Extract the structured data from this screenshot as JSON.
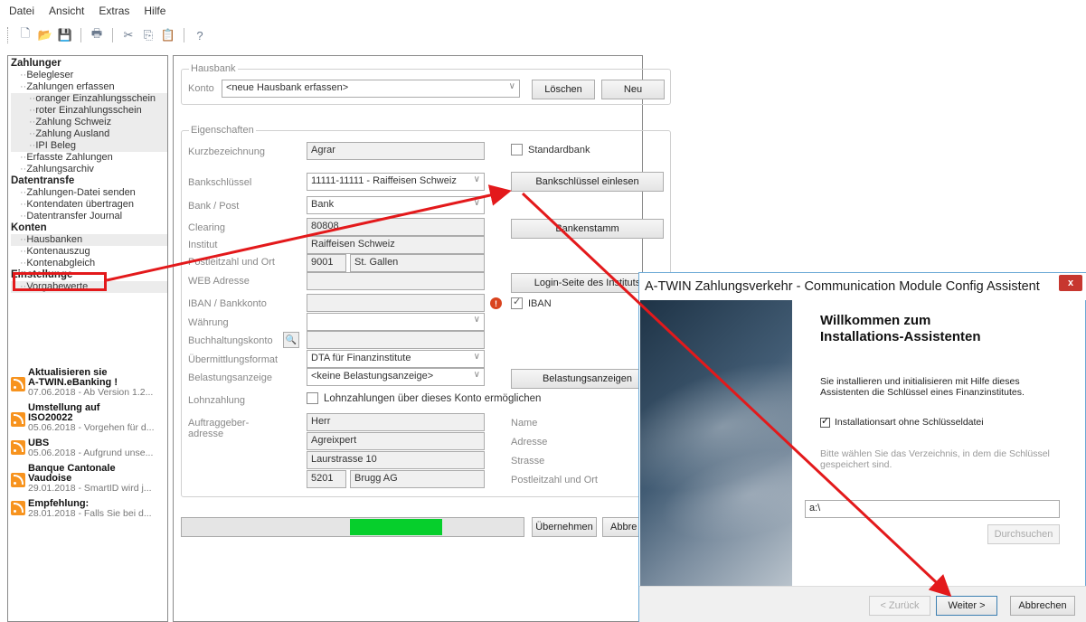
{
  "menubar": {
    "items": [
      "Datei",
      "Ansicht",
      "Extras",
      "Hilfe"
    ]
  },
  "toolbar": {
    "icons": [
      "new-icon",
      "open-icon",
      "save-icon",
      "print-icon",
      "cut-icon",
      "copy-icon",
      "paste-icon",
      "help-icon"
    ]
  },
  "nav": {
    "zahlungen": {
      "heading": "Zahlunger",
      "items": [
        "Belegleser",
        "Zahlungen erfassen",
        "oranger Einzahlungsschein",
        "roter Einzahlungsschein",
        "Zahlung Schweiz",
        "Zahlung Ausland",
        "IPI Beleg",
        "Erfasste Zahlungen",
        "Zahlungsarchiv"
      ]
    },
    "datentransfer": {
      "heading": "Datentransfe",
      "items": [
        "Zahlungen-Datei senden",
        "Kontendaten übertragen",
        "Datentransfer Journal"
      ]
    },
    "konten": {
      "heading": "Konten",
      "items": [
        "Hausbanken",
        "Kontenauszug",
        "Kontenabgleich"
      ]
    },
    "einstellungen": {
      "heading": "Einstellunge",
      "items": [
        "Vorgabewerte"
      ]
    },
    "news": [
      {
        "title1": "Aktualisieren sie",
        "title2": "A-TWIN.eBanking !",
        "sub": "07.06.2018 - Ab Version 1.2..."
      },
      {
        "title1": "Umstellung auf",
        "title2": "ISO20022",
        "sub": "05.06.2018 - Vorgehen für d..."
      },
      {
        "title1": "UBS",
        "title2": "",
        "sub": "05.06.2018 - Aufgrund unse..."
      },
      {
        "title1": "Banque Cantonale",
        "title2": "Vaudoise",
        "sub": "29.01.2018 - SmartID wird j..."
      },
      {
        "title1": "Empfehlung:",
        "title2": "",
        "sub": "28.01.2018 - Falls Sie bei d..."
      }
    ]
  },
  "hausbank": {
    "legend": "Hausbank",
    "konto_label": "Konto",
    "konto_value": "<neue Hausbank erfassen>",
    "loeschen": "Löschen",
    "neu": "Neu"
  },
  "eigenschaften": {
    "legend": "Eigenschaften",
    "kurzbezeichnung_label": "Kurzbezeichnung",
    "kurzbezeichnung_value": "Agrar",
    "standardbank_label": "Standardbank",
    "bankschluessel_label": "Bankschlüssel",
    "bankschluessel_value": "11111-11111 - Raiffeisen Schweiz",
    "bankschluessel_btn": "Bankschlüssel einlesen",
    "bankpost_label": "Bank / Post",
    "bankpost_value": "Bank",
    "clearing_label": "Clearing",
    "clearing_value": "80808",
    "bankenstamm_btn": "Bankenstamm",
    "institut_label": "Institut",
    "institut_value": "Raiffeisen Schweiz",
    "plzort_label": "Postleitzahl und Ort",
    "plz_value": "9001",
    "ort_value": "St. Gallen",
    "web_label": "WEB Adresse",
    "login_btn": "Login-Seite des Instituts",
    "iban_label": "IBAN / Bankkonto",
    "iban_chk_label": "IBAN",
    "waehrung_label": "Währung",
    "buchhaltung_label": "Buchhaltungskonto",
    "uebermittlung_label": "Übermittlungsformat",
    "uebermittlung_value": "DTA für Finanzinstitute",
    "belastung_label": "Belastungsanzeige",
    "belastung_value": "<keine Belastungsanzeige>",
    "belastung_btn": "Belastungsanzeigen",
    "lohn_label": "Lohnzahlung",
    "lohn_chk_label": "Lohnzahlungen über dieses Konto ermöglichen",
    "auftrag_label1": "Auftraggeber-",
    "auftrag_label2": "adresse",
    "name_value": "Herr",
    "name_label": "Name",
    "adresse_value": "Agreixpert",
    "adresse_label": "Adresse",
    "strasse_value": "Laurstrasse 10",
    "strasse_label": "Strasse",
    "plz2_value": "5201",
    "ort2_value": "Brugg AG",
    "plzort2_label": "Postleitzahl und Ort"
  },
  "footer": {
    "progress": 0.27,
    "uebernehmen": "Übernehmen",
    "abbrechen": "Abbre"
  },
  "dialog": {
    "title": "A-TWIN Zahlungsverkehr - Communication Module Config Assistent",
    "close": "x",
    "heading1": "Willkommen zum",
    "heading2": "Installations-Assistenten",
    "intro1": "Sie installieren und initialisieren mit Hilfe dieses",
    "intro2": "Assistenten die Schlüssel eines Finanzinstitutes.",
    "checkbox_label": "Installationsart ohne Schlüsseldatei",
    "hint1": "Bitte wählen Sie das Verzeichnis, in dem die Schlüssel",
    "hint2": "gespeichert sind.",
    "path_value": "a:\\",
    "browse": "Durchsuchen",
    "back": "< Zurück",
    "next": "Weiter >",
    "cancel": "Abbrechen"
  },
  "colors": {
    "arrow": "#e3191b",
    "progress": "#06cf2c",
    "rss": "#f7931e"
  }
}
